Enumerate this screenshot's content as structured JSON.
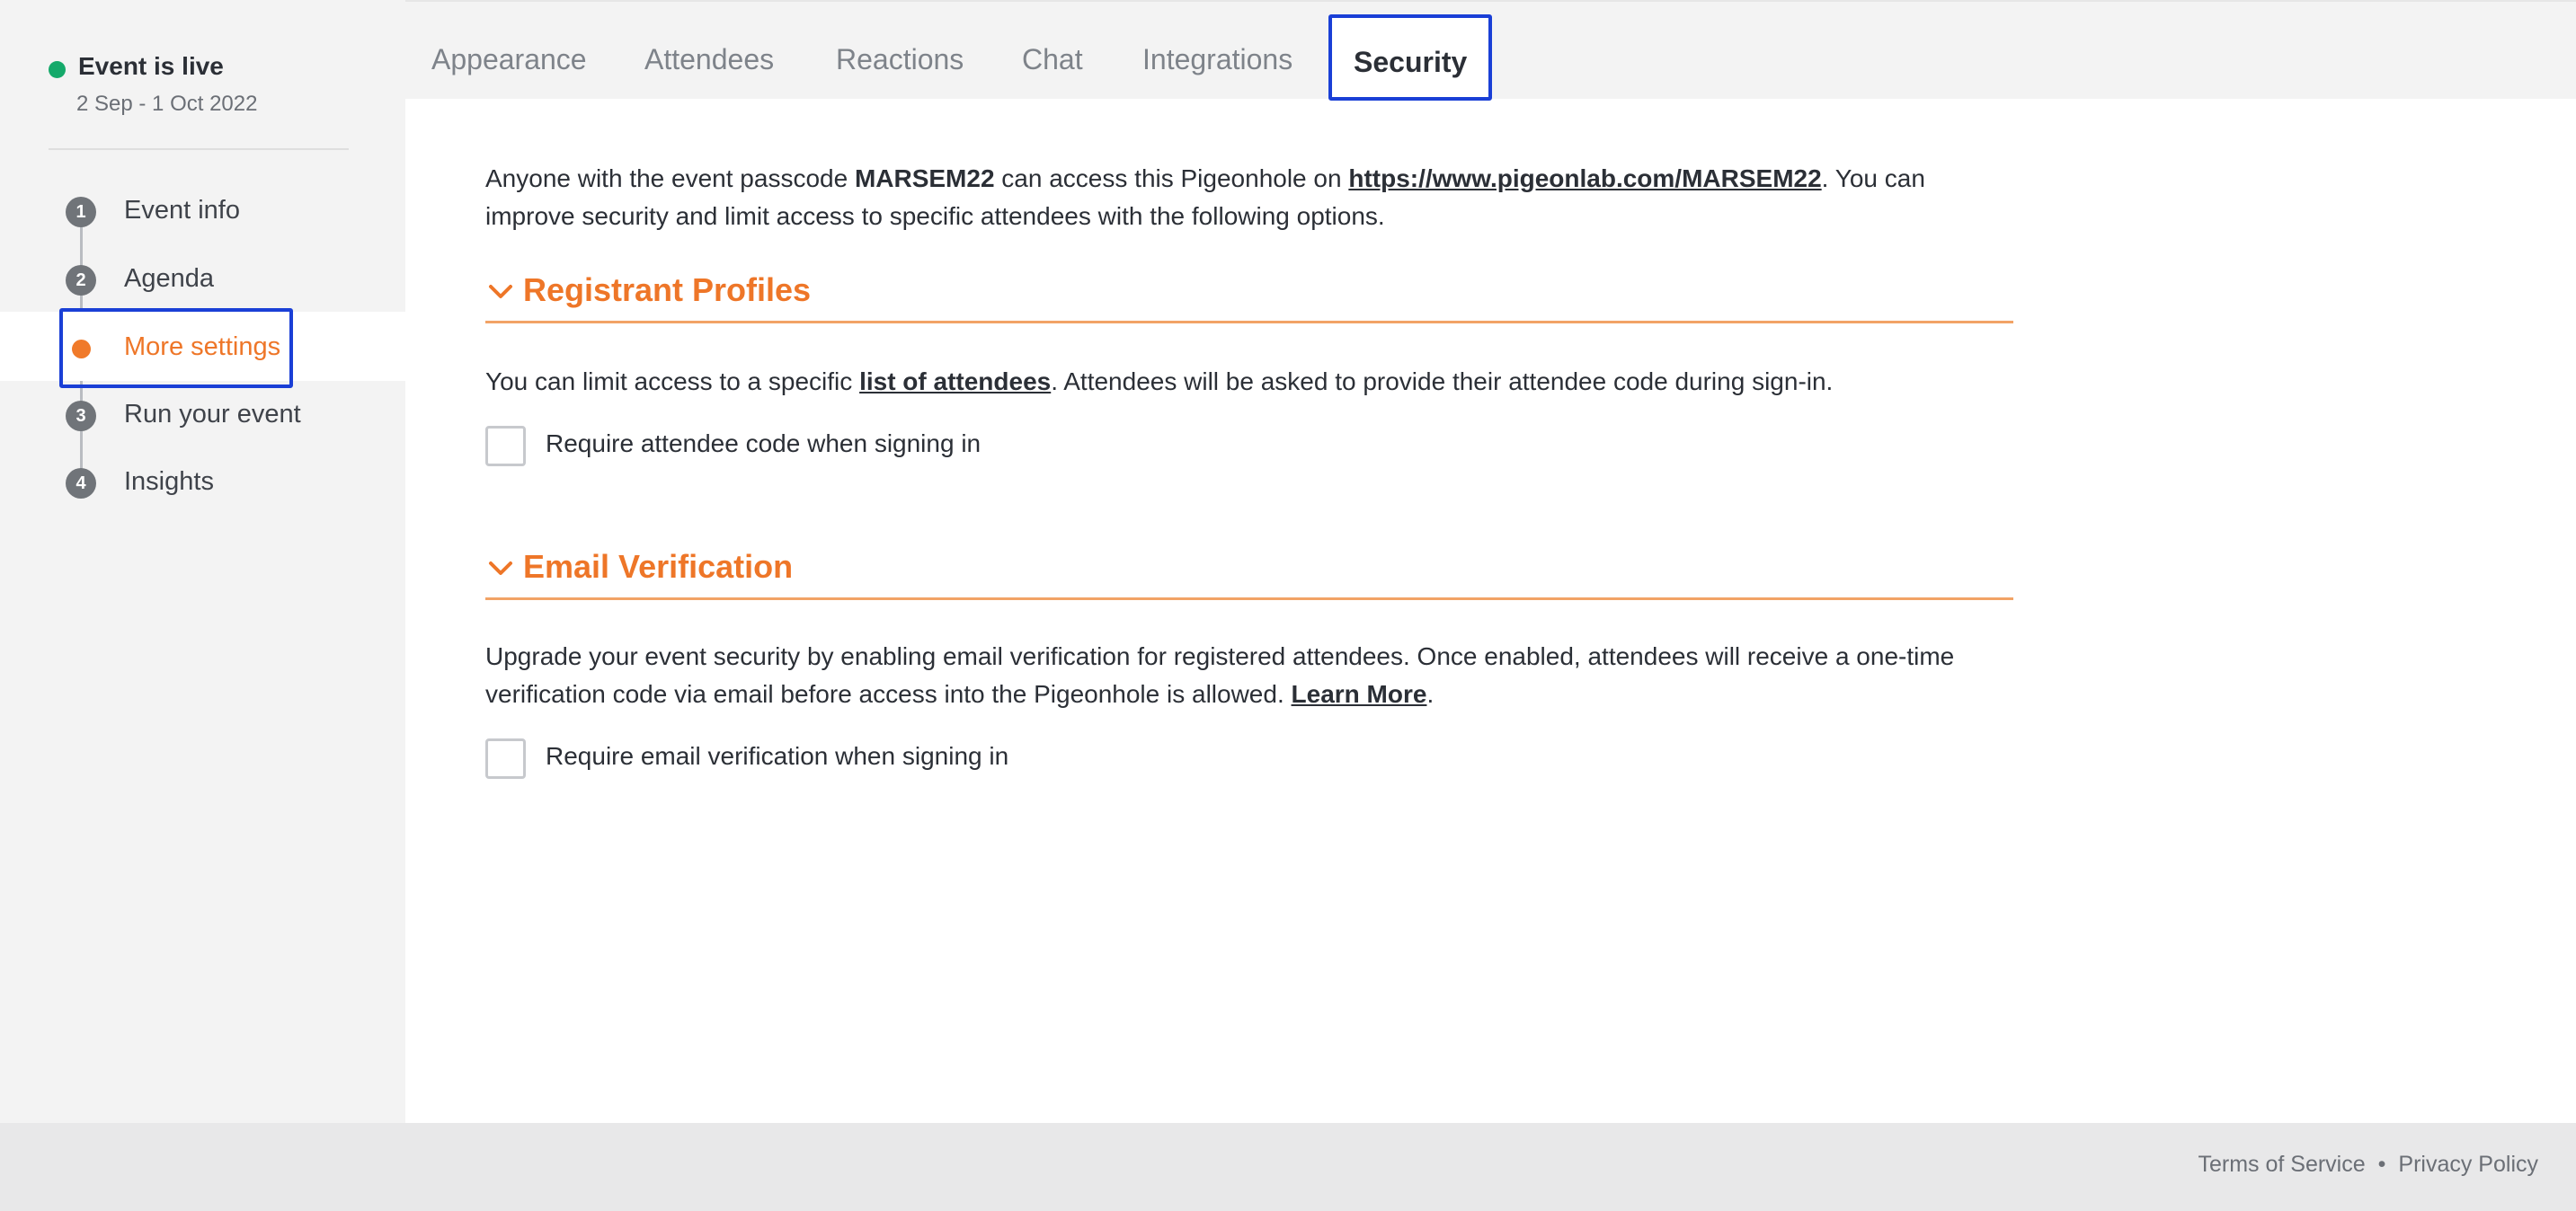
{
  "event": {
    "status_label": "Event is live",
    "date_range": "2 Sep - 1 Oct 2022",
    "status_color": "#14a96a"
  },
  "sidebar": {
    "items": [
      {
        "number": "1",
        "label": "Event info"
      },
      {
        "number": "2",
        "label": "Agenda"
      },
      {
        "number": "",
        "label": "More settings",
        "active": true
      },
      {
        "number": "3",
        "label": "Run your event"
      },
      {
        "number": "4",
        "label": "Insights"
      }
    ]
  },
  "tabs": [
    {
      "label": "Appearance"
    },
    {
      "label": "Attendees"
    },
    {
      "label": "Reactions"
    },
    {
      "label": "Chat"
    },
    {
      "label": "Integrations"
    },
    {
      "label": "Security",
      "active": true
    }
  ],
  "intro": {
    "before_passcode": "Anyone with the event passcode ",
    "passcode": "MARSEM22",
    "middle": " can access this Pigeonhole on ",
    "url": "https://www.pigeonlab.com/MARSEM22",
    "after": ". You can improve security and limit access to specific attendees with the following options."
  },
  "sections": {
    "registrant": {
      "title": "Registrant Profiles",
      "text_before": "You can limit access to a specific ",
      "link": "list of attendees",
      "text_after": ". Attendees will be asked to provide their attendee code during sign-in.",
      "checkbox_label": "Require attendee code when signing in",
      "checked": false
    },
    "email": {
      "title": "Email Verification",
      "text_before": "Upgrade your event security by enabling email verification for registered attendees. Once enabled, attendees will receive a one-time verification code via email before access into the Pigeonhole is allowed. ",
      "link": "Learn More",
      "text_after": ".",
      "checkbox_label": "Require email verification when signing in",
      "checked": false
    }
  },
  "footer": {
    "terms": "Terms of Service",
    "separator": "•",
    "privacy": "Privacy Policy"
  },
  "colors": {
    "accent": "#ee7628",
    "highlight_outline": "#1a3fd6"
  },
  "icons": {
    "section_toggle": "chevron-down-icon"
  }
}
